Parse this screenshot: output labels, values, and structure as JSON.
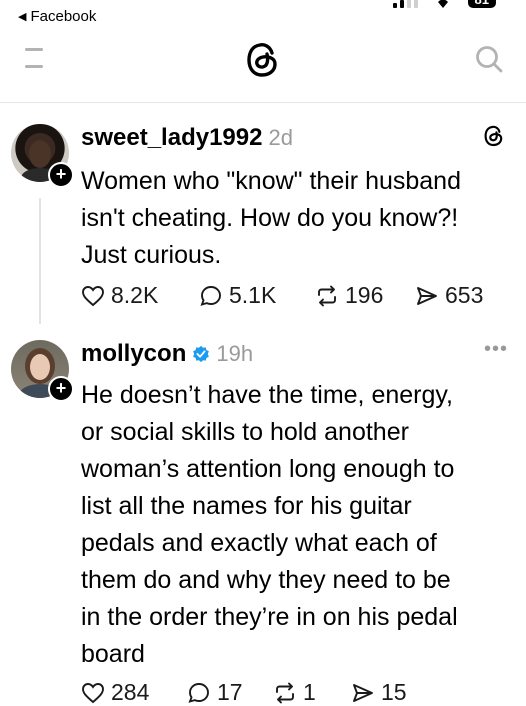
{
  "status_bar": {
    "back_label": "Facebook",
    "battery": "81"
  },
  "header": {
    "menu_icon": "menu-icon",
    "logo_icon": "threads-logo-icon",
    "search_icon": "search-icon"
  },
  "posts": [
    {
      "username": "sweet_lady1992",
      "time": "2d",
      "verified": false,
      "text": "Women who \"know\" their husband\nisn't cheating. How do you know?!\nJust curious.",
      "likes": "8.2K",
      "replies": "5.1K",
      "reposts": "196",
      "shares": "653"
    },
    {
      "username": "mollycon",
      "time": "19h",
      "verified": true,
      "more_label": "•••",
      "text": "He doesn’t have the time, energy,\nor social skills to hold another\nwoman’s attention long enough to\nlist all the names for his guitar\npedals and exactly what each of\nthem do and why they need to be\nin the order they’re in on his pedal\nboard",
      "likes": "284",
      "replies": "17",
      "reposts": "1",
      "shares": "15"
    }
  ],
  "colors": {
    "text": "#000000",
    "muted": "#9a9a9a",
    "verified": "#1d9bf0",
    "divider": "#e6e6e6"
  }
}
